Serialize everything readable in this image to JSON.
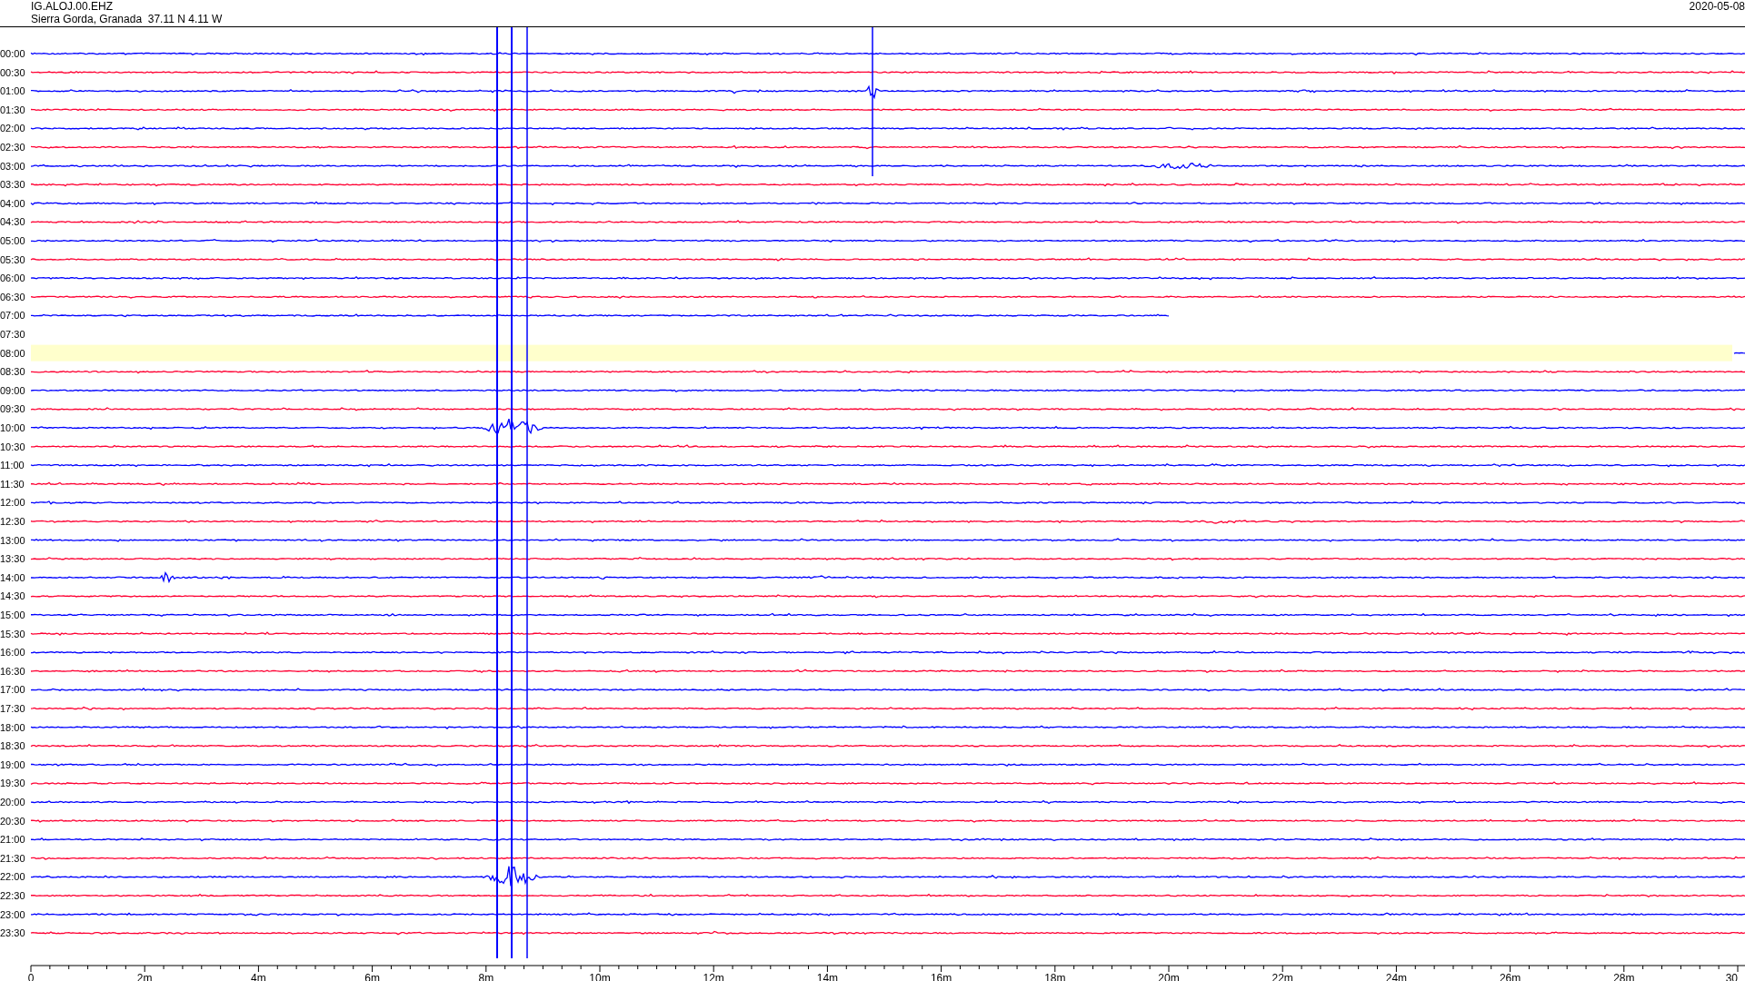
{
  "header": {
    "station": "IG.ALOJ.00.EHZ",
    "location": "Sierra Gorda, Granada  37.11 N 4.11 W",
    "date": "2020-05-08"
  },
  "rows": [
    {
      "time": "00:00",
      "kind": "trace",
      "highlighted": false
    },
    {
      "time": "00:30",
      "kind": "trace",
      "highlighted": false
    },
    {
      "time": "01:00",
      "kind": "trace",
      "highlighted": false
    },
    {
      "time": "01:30",
      "kind": "trace",
      "highlighted": false
    },
    {
      "time": "02:00",
      "kind": "trace",
      "highlighted": false
    },
    {
      "time": "02:30",
      "kind": "trace",
      "highlighted": false
    },
    {
      "time": "03:00",
      "kind": "trace",
      "highlighted": false
    },
    {
      "time": "03:30",
      "kind": "trace",
      "highlighted": false
    },
    {
      "time": "04:00",
      "kind": "trace",
      "highlighted": false
    },
    {
      "time": "04:30",
      "kind": "trace",
      "highlighted": false
    },
    {
      "time": "05:00",
      "kind": "trace",
      "highlighted": false
    },
    {
      "time": "05:30",
      "kind": "trace",
      "highlighted": false
    },
    {
      "time": "06:00",
      "kind": "trace",
      "highlighted": false
    },
    {
      "time": "06:30",
      "kind": "trace",
      "highlighted": false
    },
    {
      "time": "07:00",
      "kind": "partial",
      "highlighted": false
    },
    {
      "time": "07:30",
      "kind": "empty",
      "highlighted": false
    },
    {
      "time": "08:00",
      "kind": "live",
      "highlighted": true
    },
    {
      "time": "08:30",
      "kind": "trace",
      "highlighted": false
    },
    {
      "time": "09:00",
      "kind": "trace",
      "highlighted": false
    },
    {
      "time": "09:30",
      "kind": "trace",
      "highlighted": false
    },
    {
      "time": "10:00",
      "kind": "trace",
      "highlighted": false
    },
    {
      "time": "10:30",
      "kind": "trace",
      "highlighted": false
    },
    {
      "time": "11:00",
      "kind": "trace",
      "highlighted": false
    },
    {
      "time": "11:30",
      "kind": "trace",
      "highlighted": false
    },
    {
      "time": "12:00",
      "kind": "trace",
      "highlighted": false
    },
    {
      "time": "12:30",
      "kind": "trace",
      "highlighted": false
    },
    {
      "time": "13:00",
      "kind": "trace",
      "highlighted": false
    },
    {
      "time": "13:30",
      "kind": "trace",
      "highlighted": false
    },
    {
      "time": "14:00",
      "kind": "trace",
      "highlighted": false
    },
    {
      "time": "14:30",
      "kind": "trace",
      "highlighted": false
    },
    {
      "time": "15:00",
      "kind": "trace",
      "highlighted": false
    },
    {
      "time": "15:30",
      "kind": "trace",
      "highlighted": false
    },
    {
      "time": "16:00",
      "kind": "trace",
      "highlighted": false
    },
    {
      "time": "16:30",
      "kind": "trace",
      "highlighted": false
    },
    {
      "time": "17:00",
      "kind": "trace",
      "highlighted": false
    },
    {
      "time": "17:30",
      "kind": "trace",
      "highlighted": false
    },
    {
      "time": "18:00",
      "kind": "trace",
      "highlighted": false
    },
    {
      "time": "18:30",
      "kind": "trace",
      "highlighted": false
    },
    {
      "time": "19:00",
      "kind": "trace",
      "highlighted": false
    },
    {
      "time": "19:30",
      "kind": "trace",
      "highlighted": false
    },
    {
      "time": "20:00",
      "kind": "trace",
      "highlighted": false
    },
    {
      "time": "20:30",
      "kind": "trace",
      "highlighted": false
    },
    {
      "time": "21:00",
      "kind": "trace",
      "highlighted": false
    },
    {
      "time": "21:30",
      "kind": "trace",
      "highlighted": false
    },
    {
      "time": "22:00",
      "kind": "trace",
      "highlighted": false
    },
    {
      "time": "22:30",
      "kind": "trace",
      "highlighted": false
    },
    {
      "time": "23:00",
      "kind": "trace",
      "highlighted": false
    },
    {
      "time": "23:30",
      "kind": "trace",
      "highlighted": false
    }
  ],
  "axis": {
    "tick_labels": [
      "0",
      "2m",
      "4m",
      "6m",
      "8m",
      "10m",
      "12m",
      "14m",
      "16m",
      "18m",
      "20m",
      "22m",
      "24m",
      "26m",
      "28m",
      "30"
    ]
  }
}
